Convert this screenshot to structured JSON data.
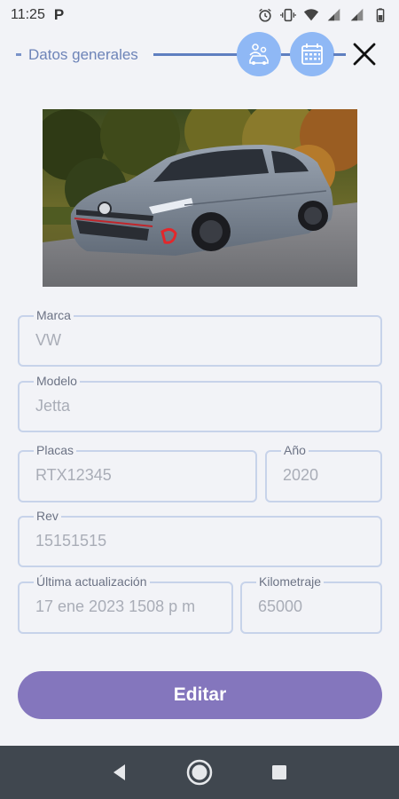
{
  "status_bar": {
    "time": "11:25",
    "app_indicator": "P",
    "icons": [
      "alarm-icon",
      "vibrate-icon",
      "wifi-icon",
      "signal-icon",
      "signal-icon",
      "battery-icon"
    ]
  },
  "stepper": {
    "label": "Datos generales",
    "steps": [
      {
        "icon": "car-person-icon"
      },
      {
        "icon": "calendar-icon"
      }
    ],
    "close_icon": "close-icon"
  },
  "vehicle": {
    "photo_alt": "car-photo"
  },
  "fields": {
    "marca": {
      "label": "Marca",
      "value": "VW"
    },
    "modelo": {
      "label": "Modelo",
      "value": "Jetta"
    },
    "placas": {
      "label": "Placas",
      "value": "RTX12345"
    },
    "anio": {
      "label": "Año",
      "value": "2020"
    },
    "rev": {
      "label": "Rev",
      "value": "15151515"
    },
    "ultima": {
      "label": "Última actualización",
      "value": "17 ene 2023 1508 p m"
    },
    "kilometraje": {
      "label": "Kilometraje",
      "value": "65000"
    }
  },
  "actions": {
    "edit_label": "Editar"
  },
  "colors": {
    "accent": "#8476bd",
    "step_circle": "#8fb8f5",
    "field_border": "#c7d3ea",
    "nav_bar": "#40474f"
  }
}
